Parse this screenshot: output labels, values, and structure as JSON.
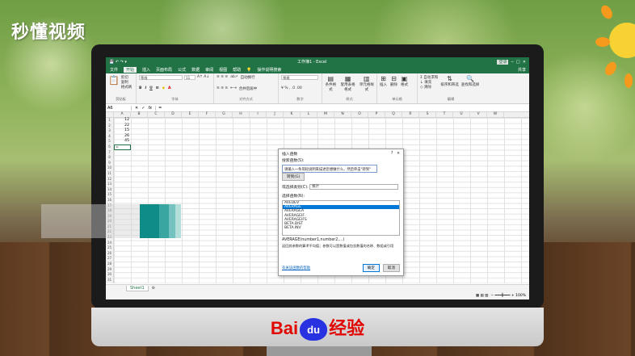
{
  "watermark": {
    "logo_text": "秒懂视频",
    "baidu_en": "Bai",
    "baidu_paw": "du",
    "baidu_cn": "经验"
  },
  "excel": {
    "window_title": "工作簿1 - Excel",
    "login_label": "登录",
    "share_label": "共享",
    "tabs": [
      "文件",
      "开始",
      "插入",
      "页面布局",
      "公式",
      "数据",
      "审阅",
      "视图",
      "帮助"
    ],
    "active_tab": "开始",
    "tell_me": "操作说明搜索",
    "ribbon": {
      "clipboard": {
        "cut": "剪切",
        "copy": "复制",
        "format_painter": "格式刷",
        "name": "剪贴板"
      },
      "font": {
        "family": "等线",
        "size": "11",
        "name": "字体"
      },
      "alignment": {
        "wrap": "自动换行",
        "merge": "合并后居中",
        "name": "对齐方式"
      },
      "number": {
        "format": "常规",
        "name": "数字"
      },
      "styles": {
        "conditional": "条件格式",
        "table": "套用表格格式",
        "cell": "单元格样式",
        "name": "样式"
      },
      "cells": {
        "insert": "插入",
        "delete": "删除",
        "format": "格式",
        "name": "单元格"
      },
      "editing": {
        "autosum": "自动求和",
        "fill": "填充",
        "clear": "清除",
        "sort": "排序和筛选",
        "find": "查找和选择",
        "name": "编辑"
      }
    },
    "name_box": "A6",
    "formula_content": "=",
    "columns": [
      "A",
      "B",
      "C",
      "D",
      "E",
      "F",
      "G",
      "H",
      "I",
      "J",
      "K",
      "L",
      "M",
      "N",
      "O",
      "P",
      "Q",
      "R",
      "S",
      "T",
      "U",
      "V",
      "W"
    ],
    "rows": [
      "1",
      "2",
      "3",
      "4",
      "5",
      "6",
      "7",
      "8",
      "9",
      "10",
      "11",
      "12",
      "13",
      "14",
      "15",
      "16",
      "17",
      "18",
      "19",
      "20",
      "21",
      "22",
      "23",
      "24",
      "25",
      "26",
      "27",
      "28",
      "29",
      "30",
      "31"
    ],
    "cell_values": [
      "12",
      "22",
      "15",
      "26",
      "45",
      "="
    ],
    "sheet_name": "Sheet1",
    "zoom": "100%"
  },
  "dialog": {
    "title": "插入函数",
    "help": "?",
    "close": "×",
    "search_label": "搜索函数(S):",
    "search_value": "请输入一条简短说明来描述您想做什么，然后单击\"转到\"",
    "go_button": "转到(G)",
    "category_label": "或选择类别(C):",
    "category_value": "统计",
    "function_list_label": "选择函数(N):",
    "functions": [
      "AVEDEV",
      "AVERAGE",
      "AVERAGEA",
      "AVERAGEIF",
      "AVERAGEIFS",
      "BETA.DIST",
      "BETA.INV"
    ],
    "selected_function": "AVERAGE",
    "signature": "AVERAGE(number1,number2,...)",
    "description": "返回其参数的算术平均值；参数可以是数值或包含数值的名称、数组或引用",
    "help_link": "有关该函数的帮助",
    "ok": "确定",
    "cancel": "取消"
  },
  "colors": {
    "excel_green": "#217346",
    "selection_blue": "#0078d7",
    "teal": "#0f8c88"
  }
}
